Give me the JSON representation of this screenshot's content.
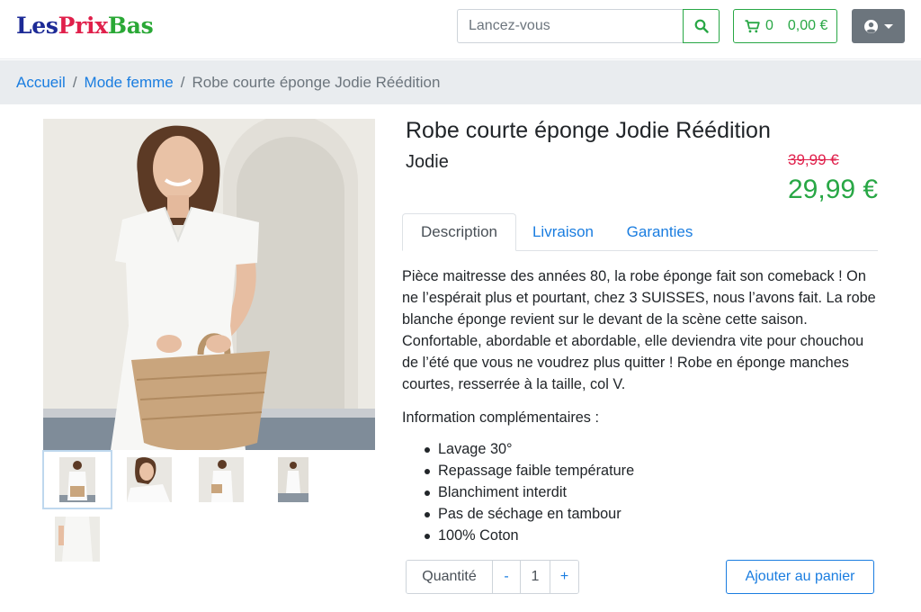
{
  "header": {
    "logo": {
      "part1": "Les",
      "part2": "Prix",
      "part3": "Bas"
    },
    "search": {
      "placeholder": "Lancez-vous",
      "icon": "search-icon"
    },
    "cart": {
      "count": "0",
      "amount": "0,00 €",
      "icon": "cart-icon"
    },
    "user": {
      "icon": "user-circle-icon"
    }
  },
  "breadcrumb": {
    "items": [
      "Accueil",
      "Mode femme"
    ],
    "current": "Robe courte éponge Jodie Réédition"
  },
  "product": {
    "title": "Robe courte éponge Jodie Réédition",
    "brand": "Jodie",
    "old_price": "39,99 €",
    "price": "29,99 €",
    "tabs": [
      "Description",
      "Livraison",
      "Garanties"
    ],
    "active_tab": "Description",
    "description": "Pièce maitresse des années 80, la robe éponge fait son comeback ! On ne l’espérait plus et pourtant, chez 3 SUISSES, nous l’avons fait. La robe blanche éponge revient sur le devant de la scène cette saison. Confortable, abordable et abordable, elle deviendra vite pour chouchou de l’été que vous ne voudrez plus quitter ! Robe en éponge manches courtes, resserrée à la taille, col V.",
    "info_title": "Information complémentaires :",
    "info_items": [
      "Lavage 30°",
      "Repassage faible température",
      "Blanchiment interdit",
      "Pas de séchage en tambour",
      "100% Coton"
    ],
    "quantity_label": "Quantité",
    "quantity_minus": "-",
    "quantity_value": "1",
    "quantity_plus": "+",
    "add_to_cart": "Ajouter au panier"
  },
  "colors": {
    "link": "#1a7de0",
    "success": "#28a745",
    "danger": "#e0204b",
    "breadcrumb_bg": "#e9ecef",
    "user_btn": "#6c757d"
  }
}
